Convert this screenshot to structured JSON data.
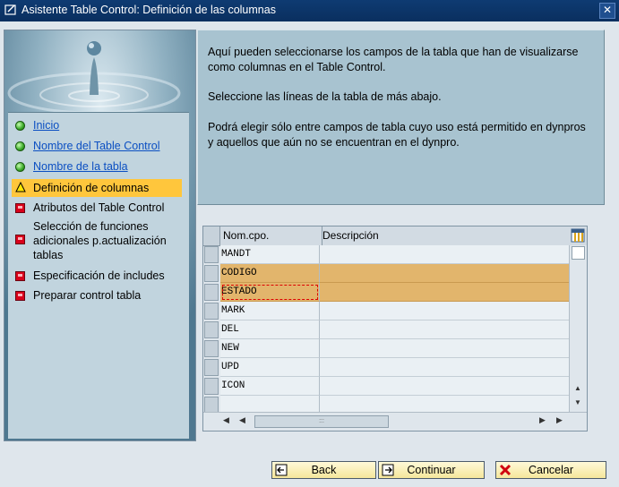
{
  "window": {
    "title": "Asistente Table Control: Definición de las columnas",
    "close_label": "✕"
  },
  "nav": [
    {
      "label": "Inicio",
      "status": "done",
      "link": true
    },
    {
      "label": "Nombre del Table Control",
      "status": "done",
      "link": true
    },
    {
      "label": "Nombre de la tabla",
      "status": "done",
      "link": true
    },
    {
      "label": "Definición de columnas",
      "status": "current",
      "link": false
    },
    {
      "label": "Atributos del Table Control",
      "status": "pending",
      "link": false
    },
    {
      "label": "Selección de funciones adicionales p.actualización tablas",
      "status": "pending",
      "link": false
    },
    {
      "label": "Especificación de includes",
      "status": "pending",
      "link": false
    },
    {
      "label": "Preparar control tabla",
      "status": "pending",
      "link": false
    }
  ],
  "info": {
    "p1": "Aquí pueden seleccionarse los campos de la tabla que han de visualizarse como columnas en el Table Control.",
    "p2": "Seleccione las líneas de la tabla de más abajo.",
    "p3": "Podrá elegir sólo entre campos de tabla cuyo uso está permitido en dynpros y aquellos que aún no se encuentran en el dynpro."
  },
  "table": {
    "columns": [
      "Nom.cpo.",
      "Descripción"
    ],
    "rows": [
      {
        "name": "MANDT",
        "description": "",
        "selected": false
      },
      {
        "name": "CODIGO",
        "description": "",
        "selected": true
      },
      {
        "name": "ESTADO",
        "description": "",
        "selected": true
      },
      {
        "name": "MARK",
        "description": "",
        "selected": false
      },
      {
        "name": "DEL",
        "description": "",
        "selected": false
      },
      {
        "name": "NEW",
        "description": "",
        "selected": false
      },
      {
        "name": "UPD",
        "description": "",
        "selected": false
      },
      {
        "name": "ICON",
        "description": "",
        "selected": false
      }
    ]
  },
  "buttons": {
    "back": "Back",
    "continue": "Continuar",
    "cancel": "Cancelar"
  },
  "colors": {
    "title_bg": "#0e3b72",
    "highlight": "#ffc63c",
    "row_selected": "#e2b56c",
    "link": "#0b4fc2"
  }
}
